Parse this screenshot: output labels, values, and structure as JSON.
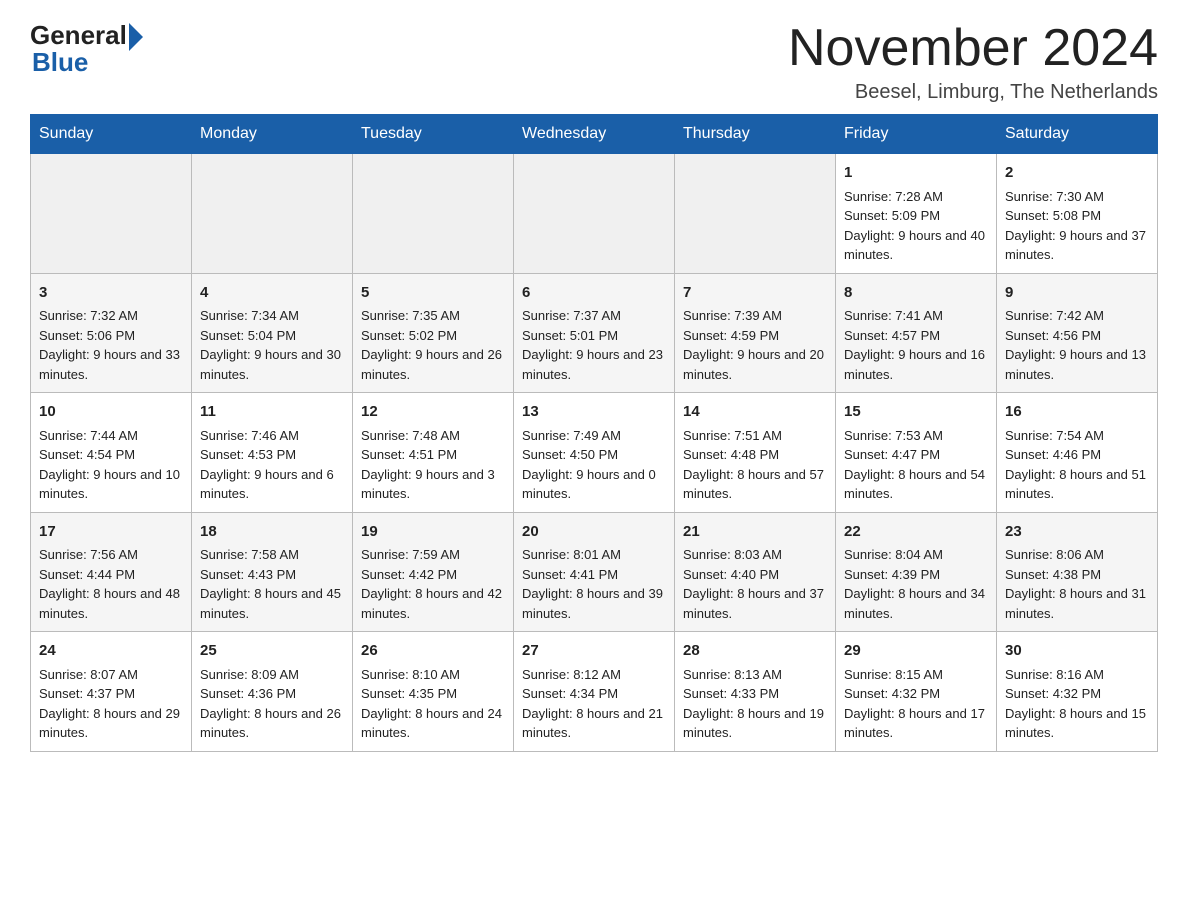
{
  "header": {
    "logo_general": "General",
    "logo_blue": "Blue",
    "month_title": "November 2024",
    "location": "Beesel, Limburg, The Netherlands"
  },
  "days_of_week": [
    "Sunday",
    "Monday",
    "Tuesday",
    "Wednesday",
    "Thursday",
    "Friday",
    "Saturday"
  ],
  "weeks": [
    [
      {
        "day": "",
        "info": ""
      },
      {
        "day": "",
        "info": ""
      },
      {
        "day": "",
        "info": ""
      },
      {
        "day": "",
        "info": ""
      },
      {
        "day": "",
        "info": ""
      },
      {
        "day": "1",
        "info": "Sunrise: 7:28 AM\nSunset: 5:09 PM\nDaylight: 9 hours and 40 minutes."
      },
      {
        "day": "2",
        "info": "Sunrise: 7:30 AM\nSunset: 5:08 PM\nDaylight: 9 hours and 37 minutes."
      }
    ],
    [
      {
        "day": "3",
        "info": "Sunrise: 7:32 AM\nSunset: 5:06 PM\nDaylight: 9 hours and 33 minutes."
      },
      {
        "day": "4",
        "info": "Sunrise: 7:34 AM\nSunset: 5:04 PM\nDaylight: 9 hours and 30 minutes."
      },
      {
        "day": "5",
        "info": "Sunrise: 7:35 AM\nSunset: 5:02 PM\nDaylight: 9 hours and 26 minutes."
      },
      {
        "day": "6",
        "info": "Sunrise: 7:37 AM\nSunset: 5:01 PM\nDaylight: 9 hours and 23 minutes."
      },
      {
        "day": "7",
        "info": "Sunrise: 7:39 AM\nSunset: 4:59 PM\nDaylight: 9 hours and 20 minutes."
      },
      {
        "day": "8",
        "info": "Sunrise: 7:41 AM\nSunset: 4:57 PM\nDaylight: 9 hours and 16 minutes."
      },
      {
        "day": "9",
        "info": "Sunrise: 7:42 AM\nSunset: 4:56 PM\nDaylight: 9 hours and 13 minutes."
      }
    ],
    [
      {
        "day": "10",
        "info": "Sunrise: 7:44 AM\nSunset: 4:54 PM\nDaylight: 9 hours and 10 minutes."
      },
      {
        "day": "11",
        "info": "Sunrise: 7:46 AM\nSunset: 4:53 PM\nDaylight: 9 hours and 6 minutes."
      },
      {
        "day": "12",
        "info": "Sunrise: 7:48 AM\nSunset: 4:51 PM\nDaylight: 9 hours and 3 minutes."
      },
      {
        "day": "13",
        "info": "Sunrise: 7:49 AM\nSunset: 4:50 PM\nDaylight: 9 hours and 0 minutes."
      },
      {
        "day": "14",
        "info": "Sunrise: 7:51 AM\nSunset: 4:48 PM\nDaylight: 8 hours and 57 minutes."
      },
      {
        "day": "15",
        "info": "Sunrise: 7:53 AM\nSunset: 4:47 PM\nDaylight: 8 hours and 54 minutes."
      },
      {
        "day": "16",
        "info": "Sunrise: 7:54 AM\nSunset: 4:46 PM\nDaylight: 8 hours and 51 minutes."
      }
    ],
    [
      {
        "day": "17",
        "info": "Sunrise: 7:56 AM\nSunset: 4:44 PM\nDaylight: 8 hours and 48 minutes."
      },
      {
        "day": "18",
        "info": "Sunrise: 7:58 AM\nSunset: 4:43 PM\nDaylight: 8 hours and 45 minutes."
      },
      {
        "day": "19",
        "info": "Sunrise: 7:59 AM\nSunset: 4:42 PM\nDaylight: 8 hours and 42 minutes."
      },
      {
        "day": "20",
        "info": "Sunrise: 8:01 AM\nSunset: 4:41 PM\nDaylight: 8 hours and 39 minutes."
      },
      {
        "day": "21",
        "info": "Sunrise: 8:03 AM\nSunset: 4:40 PM\nDaylight: 8 hours and 37 minutes."
      },
      {
        "day": "22",
        "info": "Sunrise: 8:04 AM\nSunset: 4:39 PM\nDaylight: 8 hours and 34 minutes."
      },
      {
        "day": "23",
        "info": "Sunrise: 8:06 AM\nSunset: 4:38 PM\nDaylight: 8 hours and 31 minutes."
      }
    ],
    [
      {
        "day": "24",
        "info": "Sunrise: 8:07 AM\nSunset: 4:37 PM\nDaylight: 8 hours and 29 minutes."
      },
      {
        "day": "25",
        "info": "Sunrise: 8:09 AM\nSunset: 4:36 PM\nDaylight: 8 hours and 26 minutes."
      },
      {
        "day": "26",
        "info": "Sunrise: 8:10 AM\nSunset: 4:35 PM\nDaylight: 8 hours and 24 minutes."
      },
      {
        "day": "27",
        "info": "Sunrise: 8:12 AM\nSunset: 4:34 PM\nDaylight: 8 hours and 21 minutes."
      },
      {
        "day": "28",
        "info": "Sunrise: 8:13 AM\nSunset: 4:33 PM\nDaylight: 8 hours and 19 minutes."
      },
      {
        "day": "29",
        "info": "Sunrise: 8:15 AM\nSunset: 4:32 PM\nDaylight: 8 hours and 17 minutes."
      },
      {
        "day": "30",
        "info": "Sunrise: 8:16 AM\nSunset: 4:32 PM\nDaylight: 8 hours and 15 minutes."
      }
    ]
  ]
}
